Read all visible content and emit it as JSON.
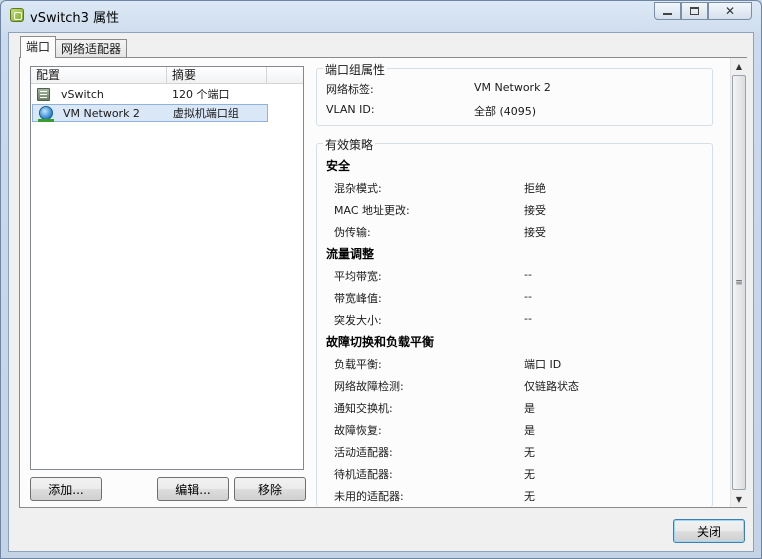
{
  "window": {
    "title": "vSwitch3 属性",
    "minimize_icon": "minimize-icon",
    "maximize_icon": "maximize-icon",
    "close_symbol": "✕"
  },
  "tabs": [
    {
      "label": "端口",
      "active": true
    },
    {
      "label": "网络适配器",
      "active": false
    }
  ],
  "list": {
    "columns": [
      "配置",
      "摘要"
    ],
    "rows": [
      {
        "icon": "vswitch-icon",
        "name": "vSwitch",
        "summary": "120 个端口",
        "selected": false
      },
      {
        "icon": "portgroup-icon",
        "name": "VM Network 2",
        "summary": "虚拟机端口组",
        "selected": true
      }
    ]
  },
  "buttons": {
    "add": "添加...",
    "edit": "编辑...",
    "remove": "移除",
    "close": "关闭"
  },
  "port_group_props": {
    "legend": "端口组属性",
    "items": [
      {
        "label": "网络标签:",
        "value": "VM Network 2"
      },
      {
        "label": "VLAN ID:",
        "value": "全部 (4095)"
      }
    ]
  },
  "policies": {
    "legend": "有效策略",
    "sections": [
      {
        "title": "安全",
        "items": [
          {
            "label": "混杂模式:",
            "value": "拒绝"
          },
          {
            "label": "MAC 地址更改:",
            "value": "接受"
          },
          {
            "label": "伪传输:",
            "value": "接受"
          }
        ]
      },
      {
        "title": "流量调整",
        "items": [
          {
            "label": "平均带宽:",
            "value": "--"
          },
          {
            "label": "带宽峰值:",
            "value": "--"
          },
          {
            "label": "突发大小:",
            "value": "--"
          }
        ]
      },
      {
        "title": "故障切换和负载平衡",
        "items": [
          {
            "label": "负载平衡:",
            "value": "端口 ID"
          },
          {
            "label": "网络故障检测:",
            "value": "仅链路状态"
          },
          {
            "label": "通知交换机:",
            "value": "是"
          },
          {
            "label": "故障恢复:",
            "value": "是"
          },
          {
            "label": "活动适配器:",
            "value": "无"
          },
          {
            "label": "待机适配器:",
            "value": "无"
          },
          {
            "label": "未用的适配器:",
            "value": "无"
          }
        ]
      }
    ]
  }
}
